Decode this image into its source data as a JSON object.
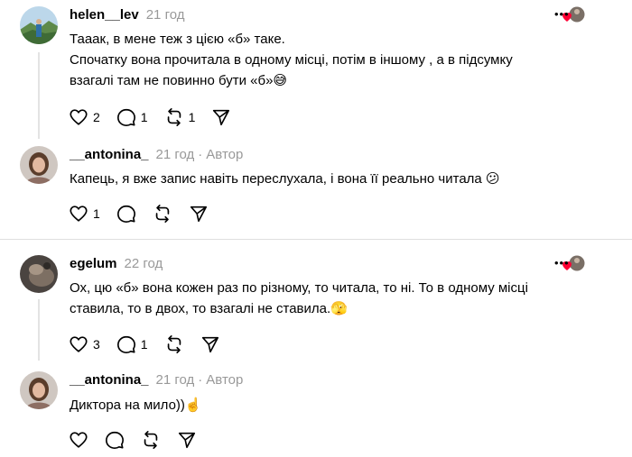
{
  "comments": [
    {
      "username": "helen__lev",
      "time": "21 год",
      "lines": [
        "Тааак, в мене теж з цією «б» таке.",
        "Спочатку вона прочитала в одному місці, потім в іншому , а в підсумку",
        "взагалі там не повинно бути «б»😅"
      ],
      "likes": "2",
      "replies": "1",
      "reposts": "1",
      "avatar_icon": "landscape-avatar"
    },
    {
      "username": "__antonina_",
      "time": "21 год",
      "author_badge": "Автор",
      "lines": [
        "Капець, я вже запис навіть переслухала, і вона її реально читала 😕"
      ],
      "likes": "1"
    },
    {
      "username": "egelum",
      "time": "22 год",
      "lines": [
        "Ох, цю «б» вона кожен раз по різному, то читала, то ні. То в одному місці",
        "ставила, то в двох, то взагалі не ставила.🫣"
      ],
      "likes": "3",
      "replies": "1"
    },
    {
      "username": "__antonina_",
      "time": "21 год",
      "author_badge": "Автор",
      "lines": [
        "Диктора на мило))☝️"
      ]
    }
  ],
  "separator": "·",
  "colors": {
    "like_heart": "#ff0034",
    "muted": "#999999",
    "divider": "#dedede"
  }
}
